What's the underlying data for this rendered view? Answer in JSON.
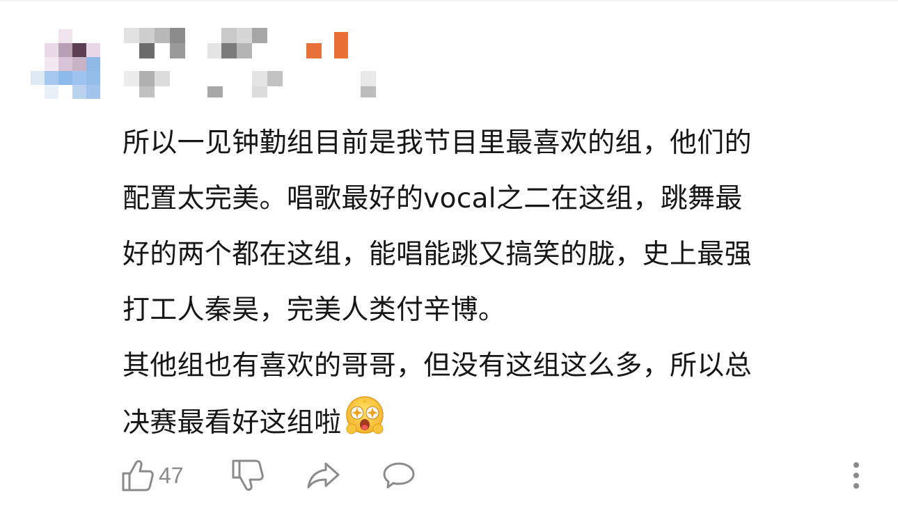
{
  "comment": {
    "lines": [
      "所以一见钟勤组目前是我节目里最喜欢的组，他们的",
      "配置太完美。唱歌最好的vocal之二在这组，跳舞最",
      "好的两个都在这组，能唱能跳又搞笑的胧，史上最强",
      "打工人秦昊，完美人类付辛博。",
      "其他组也有喜欢的哥哥，但没有这组这么多，所以总",
      "决赛最看好这组啦"
    ],
    "emoji": "starry-eyed-emoji"
  },
  "actions": {
    "like_count": "47",
    "icons": [
      "thumbs-up-icon",
      "thumbs-down-icon",
      "share-icon",
      "comment-icon",
      "more-vertical-icon"
    ]
  },
  "colors": {
    "text": "#161616",
    "icon": "#8a8a8a",
    "accent_orange": "#e8703a"
  }
}
